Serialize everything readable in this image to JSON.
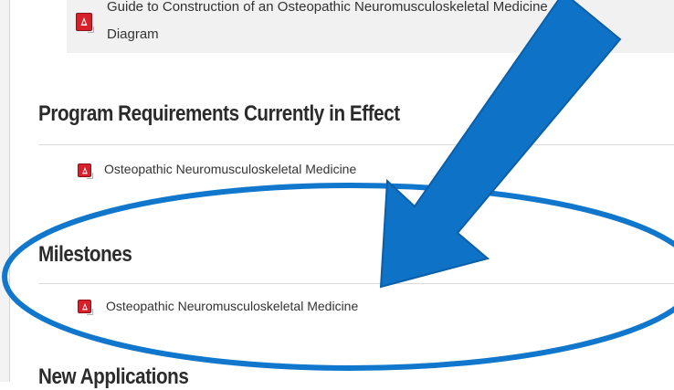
{
  "guide_box": {
    "line1": "Guide to Construction of an Osteopathic Neuromusculoskeletal Medicine",
    "line2": "Diagram",
    "icon": "pdf-icon"
  },
  "sections": {
    "program_requirements": {
      "title": "Program Requirements Currently in Effect",
      "document": "Osteopathic Neuromusculoskeletal Medicine",
      "icon": "pdf-icon"
    },
    "milestones": {
      "title": "Milestones",
      "document": "Osteopathic Neuromusculoskeletal Medicine",
      "icon": "pdf-icon"
    },
    "new_applications": {
      "title": "New Applications"
    }
  },
  "annotation": {
    "arrow_color": "#0e72c6",
    "ellipse_color": "#1177cc"
  }
}
